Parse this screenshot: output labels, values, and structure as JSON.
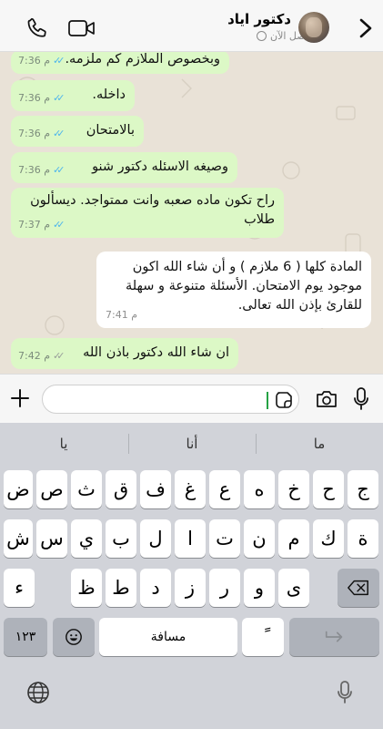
{
  "header": {
    "contact_name": "دكتور اياد",
    "status": "متصل الآن",
    "icons": [
      "phone-icon",
      "video-icon",
      "back-chevron-icon"
    ]
  },
  "messages": [
    {
      "text": "وبخصوص الملازم كم ملزمه.",
      "time": "7:36 م",
      "direction": "out",
      "read": true
    },
    {
      "text": "داخله.",
      "time": "7:36 م",
      "direction": "out",
      "read": true
    },
    {
      "text": "بالامتحان",
      "time": "7:36 م",
      "direction": "out",
      "read": true
    },
    {
      "text": "وصيغه الاسئله دكتور شنو",
      "time": "7:36 م",
      "direction": "out",
      "read": true
    },
    {
      "text": "راح تكون ماده صعبه وانت ممتواجد. ديسألون\nطلاب",
      "time": "7:37 م",
      "direction": "out",
      "read": true
    },
    {
      "text": "المادة كلها ( 6 ملازم ) و أن شاء الله اكون\nموجود يوم الامتحان. الأسئلة متنوعة و سهلة\nللقارئ بإذن الله تعالى.",
      "time": "7:41 م",
      "direction": "in"
    },
    {
      "text": "ان شاء الله دكتور باذن الله",
      "time": "7:42 م",
      "direction": "out",
      "read": false
    }
  ],
  "input": {
    "value": "",
    "icons": [
      "plus-icon",
      "sticker-icon",
      "camera-icon",
      "mic-icon"
    ]
  },
  "keyboard": {
    "suggestions": [
      "ما",
      "أنا",
      "يا"
    ],
    "row1": [
      "ج",
      "ح",
      "خ",
      "ه",
      "ع",
      "غ",
      "ف",
      "ق",
      "ث",
      "ص",
      "ض"
    ],
    "row2": [
      "ة",
      "ك",
      "م",
      "ن",
      "ت",
      "ا",
      "ل",
      "ب",
      "ي",
      "س",
      "ش"
    ],
    "row3": [
      "ى",
      "و",
      "ر",
      "ز",
      "د",
      "ط",
      "ظ",
      "ء"
    ],
    "numbers_label": "١٢٣",
    "space_label": "مسافة",
    "tanween_label": "ً",
    "icons": [
      "backspace-icon",
      "emoji-icon",
      "return-icon",
      "globe-icon",
      "mic-icon"
    ]
  }
}
